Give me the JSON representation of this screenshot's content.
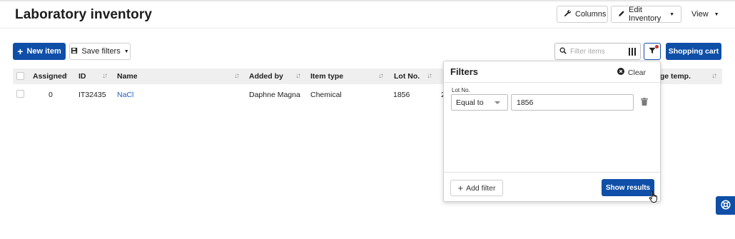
{
  "page": {
    "title": "Laboratory inventory"
  },
  "header": {
    "columns_label": "Columns",
    "edit_inventory_label": "Edit Inventory",
    "view_label": "View"
  },
  "toolbar": {
    "new_item_label": "New item",
    "save_filters_label": "Save filters",
    "search_placeholder": "Filter items",
    "shopping_cart_label": "Shopping cart"
  },
  "table": {
    "columns": [
      "Assigned",
      "ID",
      "Name",
      "Added by",
      "Item type",
      "Lot No.",
      "Storage temp."
    ],
    "rows": [
      {
        "assigned": "0",
        "id": "IT32435",
        "name": "NaCl",
        "added_by": "Daphne Magna",
        "item_type": "Chemical",
        "lot_no": "1856",
        "next_col_partial": "2"
      }
    ]
  },
  "filters_panel": {
    "title": "Filters",
    "clear_label": "Clear",
    "field_label": "Lot No.",
    "operator": "Equal to",
    "value": "1856",
    "add_filter_label": "Add filter",
    "show_results_label": "Show results"
  },
  "colors": {
    "primary": "#0f4fa8",
    "link": "#1f5fb8",
    "filter_dot": "#d0312d"
  }
}
